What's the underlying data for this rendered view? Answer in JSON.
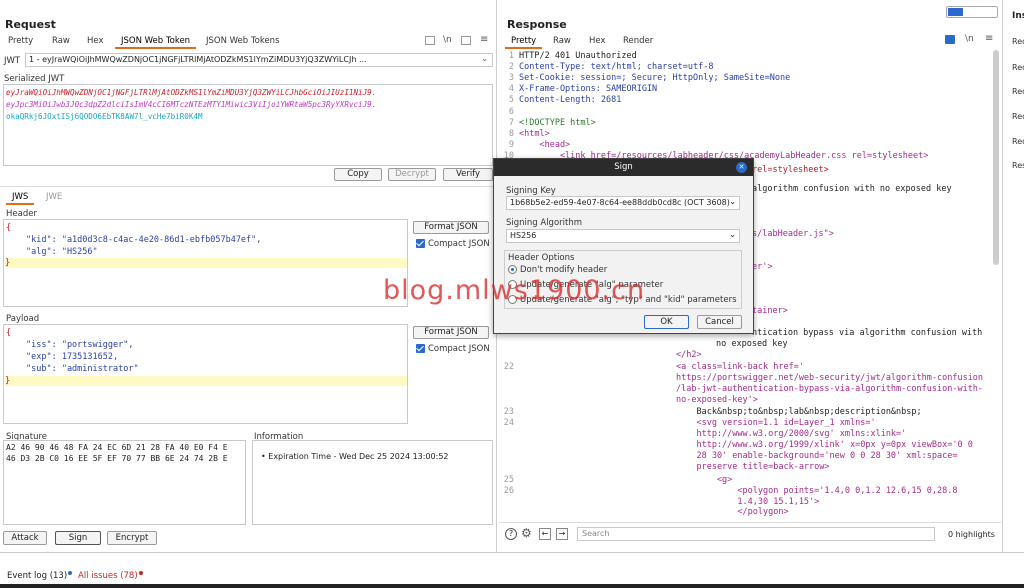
{
  "request": {
    "title": "Request",
    "tabs": [
      "Pretty",
      "Raw",
      "Hex",
      "JSON Web Token",
      "JSON Web Tokens"
    ],
    "jwt_label": "JWT",
    "jwt_select": "1 - eyJraWQiOiJhMWQwZDNjOC1jNGFjLTRlMjAtODZkMS1lYmZiMDU3YjQ3ZWYiLCJh ...",
    "serialized_label": "Serialized JWT",
    "jwt_part1": "eyJraWQiOiJhMWQwZDNjOC1jNGFjLTRlMjAtODZkMS1lYmZiMDU3YjQ3ZWYiLCJhbGciOiJIUzI1NiJ9.",
    "jwt_part2": "eyJpc3MiOiJwb3J0c3dpZ2dlciIsImV4cCI6MTczNTEzMTY1Miwic3ViIjoiYWRtaW5pc3RyYXRvciJ9.",
    "jwt_part3": "okaQRkj6JOxtISj6QODO6EbTK8AW7l_vcHe7biR0K4M",
    "copy_btn": "Copy",
    "decrypt_btn": "Decrypt",
    "verify_btn": "Verify",
    "subtabs": [
      "JWS",
      "JWE"
    ],
    "header_label": "Header",
    "header_lines": [
      "{",
      "\"kid\": \"a1d0d3c8-c4ac-4e20-86d1-ebfb057b47ef\",",
      "\"alg\": \"HS256\"",
      "}"
    ],
    "format_json": "Format JSON",
    "compact_json": "Compact JSON",
    "payload_label": "Payload",
    "payload_lines": [
      "{",
      "\"iss\": \"portswigger\",",
      "\"exp\": 1735131652,",
      "\"sub\": \"administrator\"",
      "}"
    ],
    "signature_label": "Signature",
    "signature_hex1": "A2 46 90 46 48 FA 24 EC 6D 21 28 FA 40 E0 F4 E",
    "signature_hex2": "46 D3 2B C0 16 EE 5F EF 70 77 BB 6E 24 74 2B E",
    "information_label": "Information",
    "expiration": "• Expiration Time - Wed Dec 25 2024 13:00:52",
    "attack_btn": "Attack",
    "sign_btn": "Sign",
    "encrypt_btn": "Encrypt"
  },
  "response": {
    "title": "Response",
    "tabs": [
      "Pretty",
      "Raw",
      "Hex",
      "Render"
    ],
    "lines": [
      {
        "n": "1",
        "t": "HTTP/2 401 Unauthorized"
      },
      {
        "n": "2",
        "t": "Content-Type: text/html; charset=utf-8"
      },
      {
        "n": "3",
        "t": "Set-Cookie: session=; Secure; HttpOnly; SameSite=None"
      },
      {
        "n": "4",
        "t": "X-Frame-Options: SAMEORIGIN"
      },
      {
        "n": "5",
        "t": "Content-Length: 2681"
      },
      {
        "n": "6",
        "t": ""
      },
      {
        "n": "7",
        "t": "<!DOCTYPE html>"
      },
      {
        "n": "8",
        "t": "<html>"
      },
      {
        "n": "9",
        "t": "    <head>"
      },
      {
        "n": "10",
        "t": "        <link href=/resources/labheader/css/academyLabHeader.css rel=stylesheet>"
      }
    ],
    "fragments": {
      "f1": "rel=stylesheet>",
      "f2": "algorithm confusion with no exposed key",
      "f3": "s/labHeader.js\">",
      "f4": "er'>",
      "f5": "tainer>",
      "f6": "ntication bypass via algorithm confusion with",
      "f7": "no exposed key",
      "f8": "</h2>"
    },
    "tail": [
      {
        "n": "22",
        "t": "<a class=link-back href='"
      },
      {
        "n": "",
        "t": "https://portswigger.net/web-security/jwt/algorithm-confusion"
      },
      {
        "n": "",
        "t": "/lab-jwt-authentication-bypass-via-algorithm-confusion-with-"
      },
      {
        "n": "",
        "t": "no-exposed-key'>"
      },
      {
        "n": "23",
        "t": "    Back&nbsp;to&nbsp;lab&nbsp;description&nbsp;"
      },
      {
        "n": "24",
        "t": "    <svg version=1.1 id=Layer_1 xmlns='"
      },
      {
        "n": "",
        "t": "    http://www.w3.org/2000/svg' xmlns:xlink='"
      },
      {
        "n": "",
        "t": "    http://www.w3.org/1999/xlink' x=0px y=0px viewBox='0 0"
      },
      {
        "n": "",
        "t": "    28 30' enable-background='new 0 0 28 30' xml:space="
      },
      {
        "n": "",
        "t": "    preserve title=back-arrow>"
      },
      {
        "n": "25",
        "t": "        <g>"
      },
      {
        "n": "26",
        "t": "            <polygon points='1.4,0 0,1.2 12.6,15 0,28.8"
      },
      {
        "n": "",
        "t": "            1.4,30 15.1,15'>"
      },
      {
        "n": "",
        "t": "            </polygon>"
      }
    ],
    "search_placeholder": "Search",
    "highlights": "0 highlights"
  },
  "inspector": {
    "title": "Ins",
    "items": [
      "Req",
      "Req",
      "Req",
      "Req",
      "Req",
      "Res"
    ]
  },
  "dialog": {
    "title": "Sign",
    "signing_key_label": "Signing Key",
    "signing_key_value": "1b68b5e2-ed59-4e07-8c64-ee88ddb0cd8c (OCT 3608)",
    "algorithm_label": "Signing Algorithm",
    "algorithm_value": "HS256",
    "header_options_label": "Header Options",
    "opt1": "Don't modify header",
    "opt2": "Update/generate \"alg\" parameter",
    "opt3": "Update/generate \"alg\", \"typ\" and \"kid\" parameters",
    "ok_btn": "OK",
    "cancel_btn": "Cancel"
  },
  "watermark": "blog.mlws1900.cn",
  "status": {
    "event_log": "Event log (13)",
    "all_issues": "All issues (78)"
  }
}
